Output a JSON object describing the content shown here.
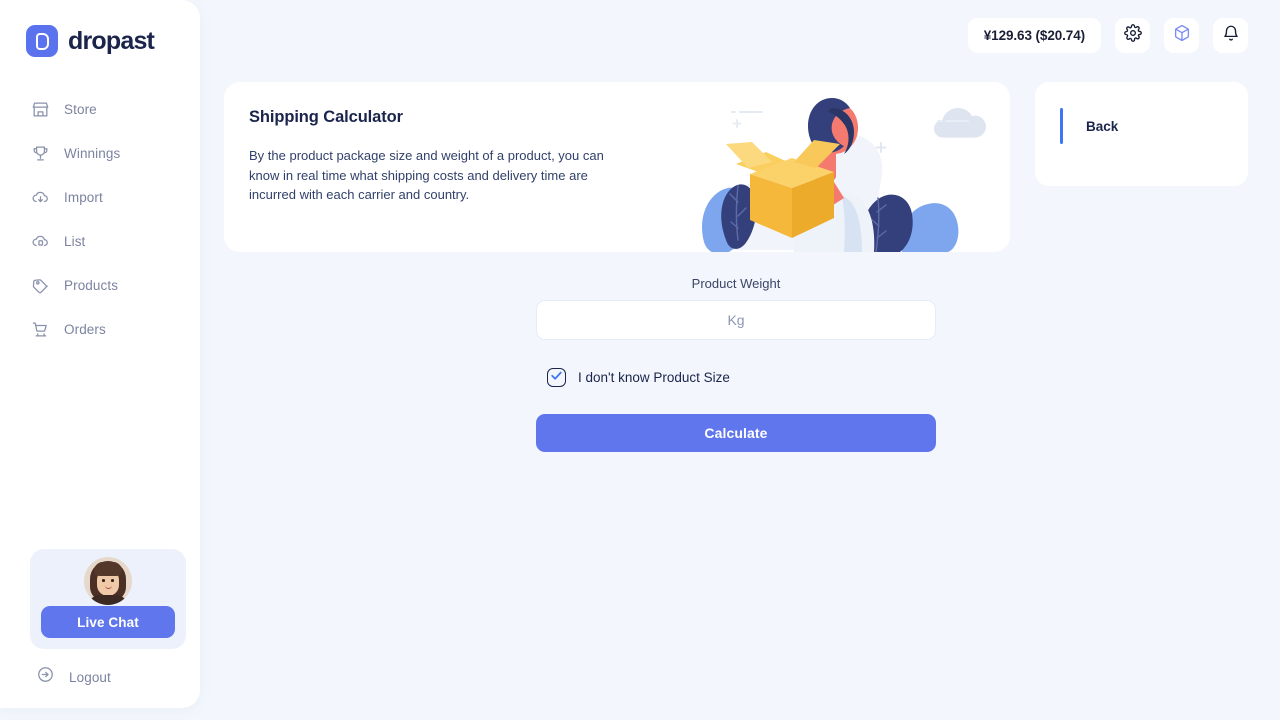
{
  "brand": {
    "name": "dropast",
    "logo_icon": "dropast-d-logo",
    "accent_color": "#5b72ee"
  },
  "sidebar": {
    "items": [
      {
        "label": "Store",
        "icon": "store-icon"
      },
      {
        "label": "Winnings",
        "icon": "trophy-icon"
      },
      {
        "label": "Import",
        "icon": "cloud-download-icon"
      },
      {
        "label": "List",
        "icon": "cloud-list-icon"
      },
      {
        "label": "Products",
        "icon": "tag-icon"
      },
      {
        "label": "Orders",
        "icon": "shopping-cart-icon"
      }
    ],
    "live_chat": {
      "button_label": "Live Chat",
      "avatar_icon": "support-agent-avatar",
      "button_color": "#5f76ec"
    },
    "logout": {
      "label": "Logout",
      "icon": "logout-arrow-icon"
    }
  },
  "header": {
    "balance": "¥129.63 ($20.74)",
    "actions": [
      {
        "icon": "gear-icon",
        "color": "#1b254b"
      },
      {
        "icon": "package-box-icon",
        "color": "#7b8cf5"
      },
      {
        "icon": "bell-icon",
        "color": "#1b254b"
      }
    ]
  },
  "hero": {
    "title": "Shipping Calculator",
    "description": "By the product package size and weight of a product, you can know in real time what shipping costs and delivery time are incurred with each carrier and country.",
    "illustration_icon": "person-holding-package-illustration"
  },
  "back_panel": {
    "label": "Back",
    "accent_color": "#3b76f6"
  },
  "form": {
    "weight_label": "Product Weight",
    "weight_value": "",
    "weight_placeholder": "Kg",
    "checkbox_label": "I don't know Product Size",
    "checkbox_checked": true,
    "submit_label": "Calculate",
    "submit_color": "#6076ec"
  }
}
